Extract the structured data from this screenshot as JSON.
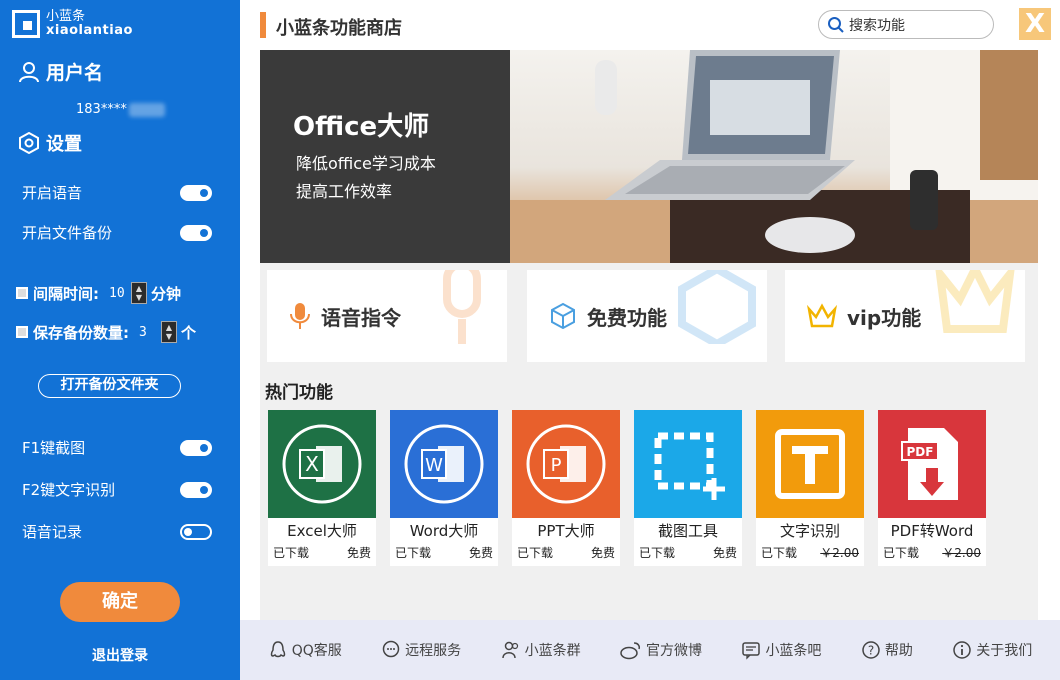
{
  "sidebar": {
    "logo_cn": "小蓝条",
    "logo_en": "xiaolantiao",
    "username": "用户名",
    "phone": "183****",
    "settings_label": "设置",
    "voice_on_label": "开启语音",
    "backup_on_label": "开启文件备份",
    "interval_label": "间隔时间:",
    "interval_value": "10",
    "interval_unit": "分钟",
    "backup_count_label": "保存备份数量:",
    "backup_count_value": "3",
    "backup_count_unit": "个",
    "open_backup_folder": "打开备份文件夹",
    "f1_label": "F1键截图",
    "f2_label": "F2键文字识别",
    "voice_record_label": "语音记录",
    "confirm": "确定",
    "logout": "退出登录"
  },
  "main": {
    "title": "小蓝条功能商店",
    "search_placeholder": "搜索功能",
    "close_label": "X",
    "banner": {
      "heading": "Office大师",
      "line1": "降低office学习成本",
      "line2": "提高工作效率"
    },
    "categories": [
      {
        "label": "语音指令",
        "icon": "microphone-icon"
      },
      {
        "label": "免费功能",
        "icon": "cube-icon"
      },
      {
        "label": "vip功能",
        "icon": "crown-icon"
      }
    ],
    "hot_title": "热门功能",
    "apps": [
      {
        "name": "Excel大师",
        "status": "已下载",
        "price": "免费",
        "color": "#1e7145"
      },
      {
        "name": "Word大师",
        "status": "已下载",
        "price": "免费",
        "color": "#2a6fd6"
      },
      {
        "name": "PPT大师",
        "status": "已下载",
        "price": "免费",
        "color": "#e8602c"
      },
      {
        "name": "截图工具",
        "status": "已下载",
        "price": "免费",
        "color": "#1ba8e8"
      },
      {
        "name": "文字识别",
        "status": "已下载",
        "price": "￥2.00",
        "color": "#f29b0c"
      },
      {
        "name": "PDF转Word",
        "status": "已下载",
        "price": "￥2.00",
        "color": "#d8363c"
      }
    ]
  },
  "bottom_bar": [
    {
      "label": "QQ客服",
      "icon": "qq-icon"
    },
    {
      "label": "远程服务",
      "icon": "chat-icon"
    },
    {
      "label": "小蓝条群",
      "icon": "group-icon"
    },
    {
      "label": "官方微博",
      "icon": "weibo-icon"
    },
    {
      "label": "小蓝条吧",
      "icon": "message-icon"
    },
    {
      "label": "帮助",
      "icon": "help-icon"
    },
    {
      "label": "关于我们",
      "icon": "info-icon"
    }
  ],
  "colors": {
    "sidebar_bg": "#1272d6",
    "accent_orange": "#f08a3c"
  }
}
